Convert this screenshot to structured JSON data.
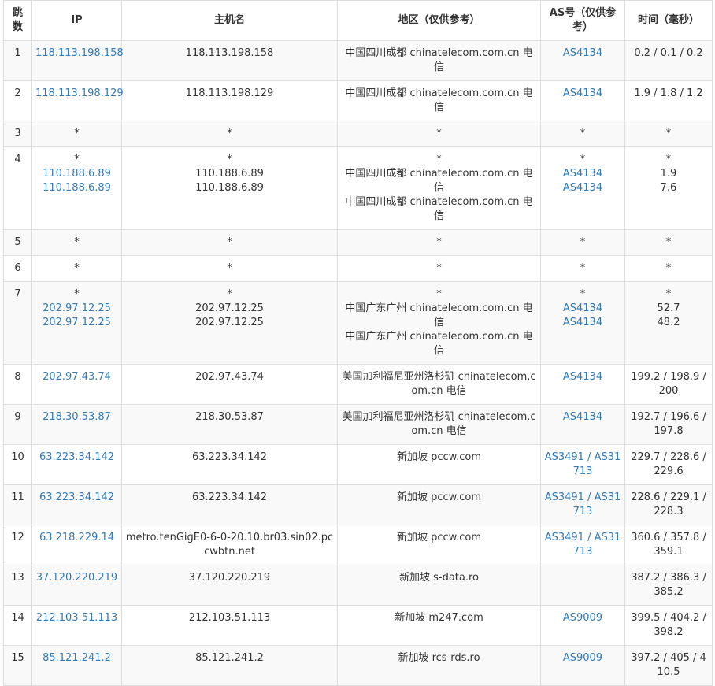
{
  "columns": [
    "跳数",
    "IP",
    "主机名",
    "地区（仅供参考）",
    "AS号（仅供参考）",
    "时间（毫秒）"
  ],
  "rows": [
    {
      "hop": "1",
      "ip": [
        "118.113.198.158"
      ],
      "host": [
        "118.113.198.158"
      ],
      "region": [
        "中国四川成都 chinatelecom.com.cn 电信"
      ],
      "as": [
        "AS4134"
      ],
      "time": [
        "0.2 / 0.1 / 0.2"
      ]
    },
    {
      "hop": "2",
      "ip": [
        "118.113.198.129"
      ],
      "host": [
        "118.113.198.129"
      ],
      "region": [
        "中国四川成都 chinatelecom.com.cn 电信"
      ],
      "as": [
        "AS4134"
      ],
      "time": [
        "1.9 / 1.8 / 1.2"
      ]
    },
    {
      "hop": "3",
      "ip": [
        "*"
      ],
      "host": [
        "*"
      ],
      "region": [
        "*"
      ],
      "as": [
        "*"
      ],
      "time": [
        "*"
      ]
    },
    {
      "hop": "4",
      "ip": [
        "*",
        "110.188.6.89",
        "110.188.6.89"
      ],
      "host": [
        "*",
        "110.188.6.89",
        "110.188.6.89"
      ],
      "region": [
        "*",
        "中国四川成都 chinatelecom.com.cn 电信",
        "中国四川成都 chinatelecom.com.cn 电信"
      ],
      "as": [
        "*",
        "AS4134",
        "AS4134"
      ],
      "time": [
        "*",
        "1.9",
        "7.6"
      ]
    },
    {
      "hop": "5",
      "ip": [
        "*"
      ],
      "host": [
        "*"
      ],
      "region": [
        "*"
      ],
      "as": [
        "*"
      ],
      "time": [
        "*"
      ]
    },
    {
      "hop": "6",
      "ip": [
        "*"
      ],
      "host": [
        "*"
      ],
      "region": [
        "*"
      ],
      "as": [
        "*"
      ],
      "time": [
        "*"
      ]
    },
    {
      "hop": "7",
      "ip": [
        "*",
        "202.97.12.25",
        "202.97.12.25"
      ],
      "host": [
        "*",
        "202.97.12.25",
        "202.97.12.25"
      ],
      "region": [
        "*",
        "中国广东广州 chinatelecom.com.cn 电信",
        "中国广东广州 chinatelecom.com.cn 电信"
      ],
      "as": [
        "*",
        "AS4134",
        "AS4134"
      ],
      "time": [
        "*",
        "52.7",
        "48.2"
      ]
    },
    {
      "hop": "8",
      "ip": [
        "202.97.43.74"
      ],
      "host": [
        "202.97.43.74"
      ],
      "region": [
        "美国加利福尼亚州洛杉矶 chinatelecom.com.cn 电信"
      ],
      "as": [
        "AS4134"
      ],
      "time": [
        "199.2 / 198.9 / 200"
      ]
    },
    {
      "hop": "9",
      "ip": [
        "218.30.53.87"
      ],
      "host": [
        "218.30.53.87"
      ],
      "region": [
        "美国加利福尼亚州洛杉矶 chinatelecom.com.cn 电信"
      ],
      "as": [
        "AS4134"
      ],
      "time": [
        "192.7 / 196.6 / 197.8"
      ]
    },
    {
      "hop": "10",
      "ip": [
        "63.223.34.142"
      ],
      "host": [
        "63.223.34.142"
      ],
      "region": [
        "新加坡 pccw.com"
      ],
      "as": [
        "AS3491 / AS31713"
      ],
      "time": [
        "229.7 / 228.6 / 229.6"
      ]
    },
    {
      "hop": "11",
      "ip": [
        "63.223.34.142"
      ],
      "host": [
        "63.223.34.142"
      ],
      "region": [
        "新加坡 pccw.com"
      ],
      "as": [
        "AS3491 / AS31713"
      ],
      "time": [
        "228.6 / 229.1 / 228.3"
      ]
    },
    {
      "hop": "12",
      "ip": [
        "63.218.229.14"
      ],
      "host": [
        "metro.tenGigE0-6-0-20.10.br03.sin02.pccwbtn.net"
      ],
      "region": [
        "新加坡 pccw.com"
      ],
      "as": [
        "AS3491 / AS31713"
      ],
      "time": [
        "360.6 / 357.8 / 359.1"
      ]
    },
    {
      "hop": "13",
      "ip": [
        "37.120.220.219"
      ],
      "host": [
        "37.120.220.219"
      ],
      "region": [
        "新加坡 s-data.ro"
      ],
      "as": [
        ""
      ],
      "time": [
        "387.2 / 386.3 / 385.2"
      ]
    },
    {
      "hop": "14",
      "ip": [
        "212.103.51.113"
      ],
      "host": [
        "212.103.51.113"
      ],
      "region": [
        "新加坡 m247.com"
      ],
      "as": [
        "AS9009"
      ],
      "time": [
        "399.5 / 404.2 / 398.2"
      ]
    },
    {
      "hop": "15",
      "ip": [
        "85.121.241.2"
      ],
      "host": [
        "85.121.241.2"
      ],
      "region": [
        "新加坡 rcs-rds.ro"
      ],
      "as": [
        "AS9009"
      ],
      "time": [
        "397.2 / 405 / 410.5"
      ]
    }
  ],
  "colors": {
    "link": "#337ab7",
    "text": "#333333",
    "stripe": "#f9f9f9",
    "border": "#dddddd"
  }
}
